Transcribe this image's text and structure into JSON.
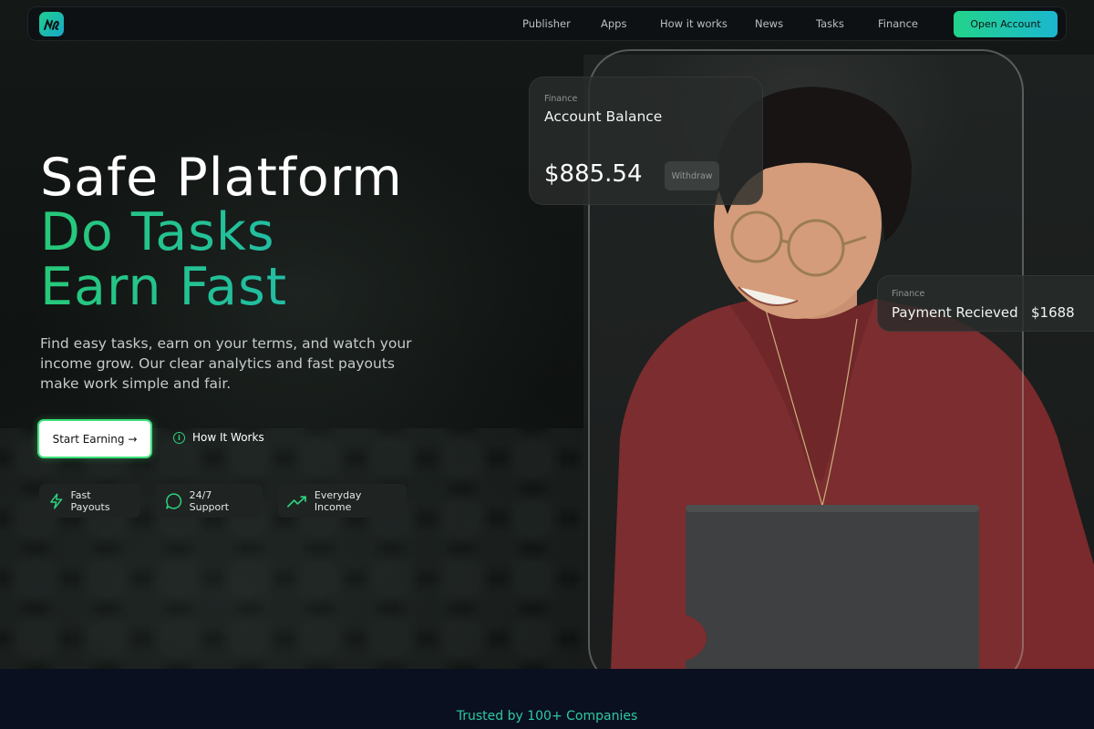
{
  "nav": {
    "links": [
      "Publisher",
      "Apps",
      "How it works",
      "News",
      "Tasks",
      "Finance"
    ],
    "cta": "Open Account"
  },
  "hero": {
    "headline_line1": "Safe Platform",
    "headline_line2": "Do Tasks",
    "headline_line3": "Earn Fast",
    "lead": "Find easy tasks, earn on your terms, and watch your income grow. Our clear analytics and fast payouts make work simple and fair.",
    "primary_button": "Start Earning →",
    "secondary_link": "How It Works",
    "features": [
      "Fast Payouts",
      "24/7 Support",
      "Everyday Income"
    ]
  },
  "balance_card": {
    "label": "Finance",
    "title": "Account Balance",
    "amount": "$885.54",
    "button": "Withdraw"
  },
  "payment_card": {
    "label": "Finance",
    "title": "Payment Recieved",
    "amount": "$1688"
  },
  "trusted": "Trusted by 100+ Companies",
  "colors": {
    "accent_green": "#22d38a",
    "accent_teal": "#1bb7cf",
    "strip_bg": "#0a1020"
  }
}
